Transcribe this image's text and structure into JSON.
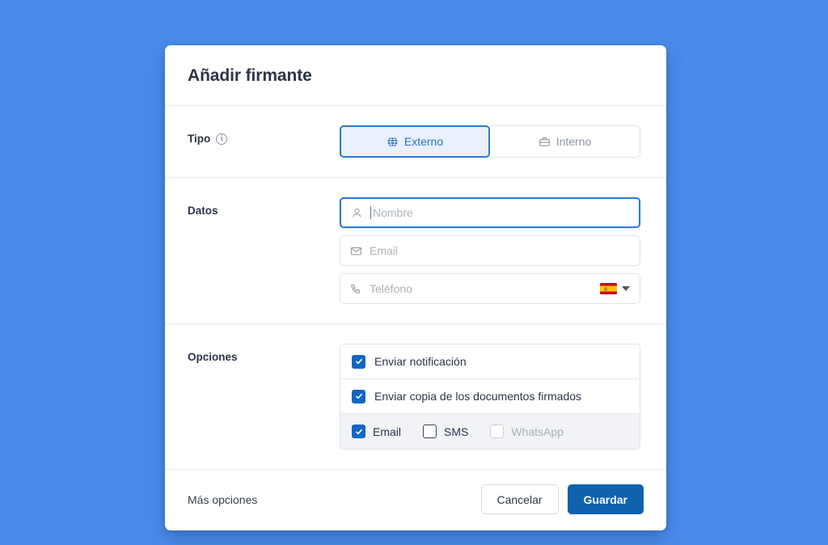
{
  "theme": {
    "page_background": "#4a8ceb",
    "accent_blue": "#1266c4",
    "primary_button": "#0f62ae",
    "selected_tab_bg": "#e8f1fd",
    "selected_tab_border": "#2e7ad1",
    "text_dark": "#2c3547",
    "text_muted": "#acb2bd"
  },
  "dialog": {
    "title": "Añadir firmante"
  },
  "type_section": {
    "label": "Tipo",
    "info_icon": "info-circle-icon",
    "info_glyph": "i",
    "options": [
      {
        "label": "Externo",
        "icon": "globe-icon",
        "selected": true
      },
      {
        "label": "Interno",
        "icon": "briefcase-icon",
        "selected": false
      }
    ]
  },
  "data_section": {
    "label": "Datos",
    "fields": [
      {
        "name": "name",
        "placeholder": "Nombre",
        "value": "",
        "icon": "user-icon",
        "focused": true
      },
      {
        "name": "email",
        "placeholder": "Email",
        "value": "",
        "icon": "envelope-icon",
        "focused": false
      },
      {
        "name": "phone",
        "placeholder": "Teléfono",
        "value": "",
        "icon": "phone-icon",
        "focused": false
      }
    ],
    "phone_country": {
      "flag": "spain-flag-icon",
      "caret": "chevron-down-icon"
    }
  },
  "options_section": {
    "label": "Opciones",
    "rows": [
      {
        "label": "Enviar notificación",
        "checked": true
      },
      {
        "label": "Enviar copia de los documentos firmados",
        "checked": true
      }
    ],
    "channels": [
      {
        "label": "Email",
        "checked": true,
        "disabled": false
      },
      {
        "label": "SMS",
        "checked": false,
        "disabled": false
      },
      {
        "label": "WhatsApp",
        "checked": false,
        "disabled": true
      }
    ]
  },
  "footer": {
    "more_options": "Más opciones",
    "cancel": "Cancelar",
    "save": "Guardar"
  }
}
